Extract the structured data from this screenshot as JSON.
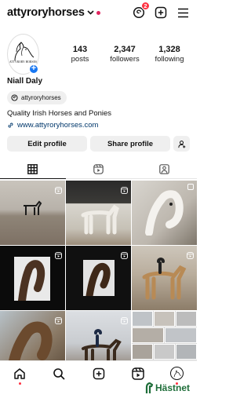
{
  "header": {
    "username": "attyroryhorses",
    "notification_count": "2"
  },
  "profile": {
    "avatar_text": "ATTYRORY HORSES",
    "posts_count": "143",
    "posts_label": "posts",
    "followers_count": "2,347",
    "followers_label": "followers",
    "following_count": "1,328",
    "following_label": "following",
    "name": "Niall Daly",
    "threads_handle": "attyroryhorses",
    "bio": "Quality Irish Horses and Ponies",
    "link": "www.attyroryhorses.com"
  },
  "buttons": {
    "edit_profile": "Edit profile",
    "share_profile": "Share profile"
  },
  "tabs": [
    "grid-icon",
    "reels-icon",
    "tagged-icon"
  ],
  "grid": {
    "posts": [
      {
        "type": "reel"
      },
      {
        "type": "reel"
      },
      {
        "type": "multi"
      },
      {
        "type": "reel"
      },
      {
        "type": "reel"
      },
      {
        "type": "reel"
      },
      {
        "type": "reel"
      },
      {
        "type": "reel"
      },
      {
        "type": "multi"
      }
    ]
  },
  "bottom_nav": [
    "home-icon",
    "search-icon",
    "create-icon",
    "reels-icon",
    "profile-icon"
  ],
  "watermark": "Hästnet",
  "colors": {
    "accent_red": "#ff3040",
    "link_blue": "#00376b",
    "add_badge_blue": "#1877f2",
    "watermark_green": "#1f6e3a"
  }
}
